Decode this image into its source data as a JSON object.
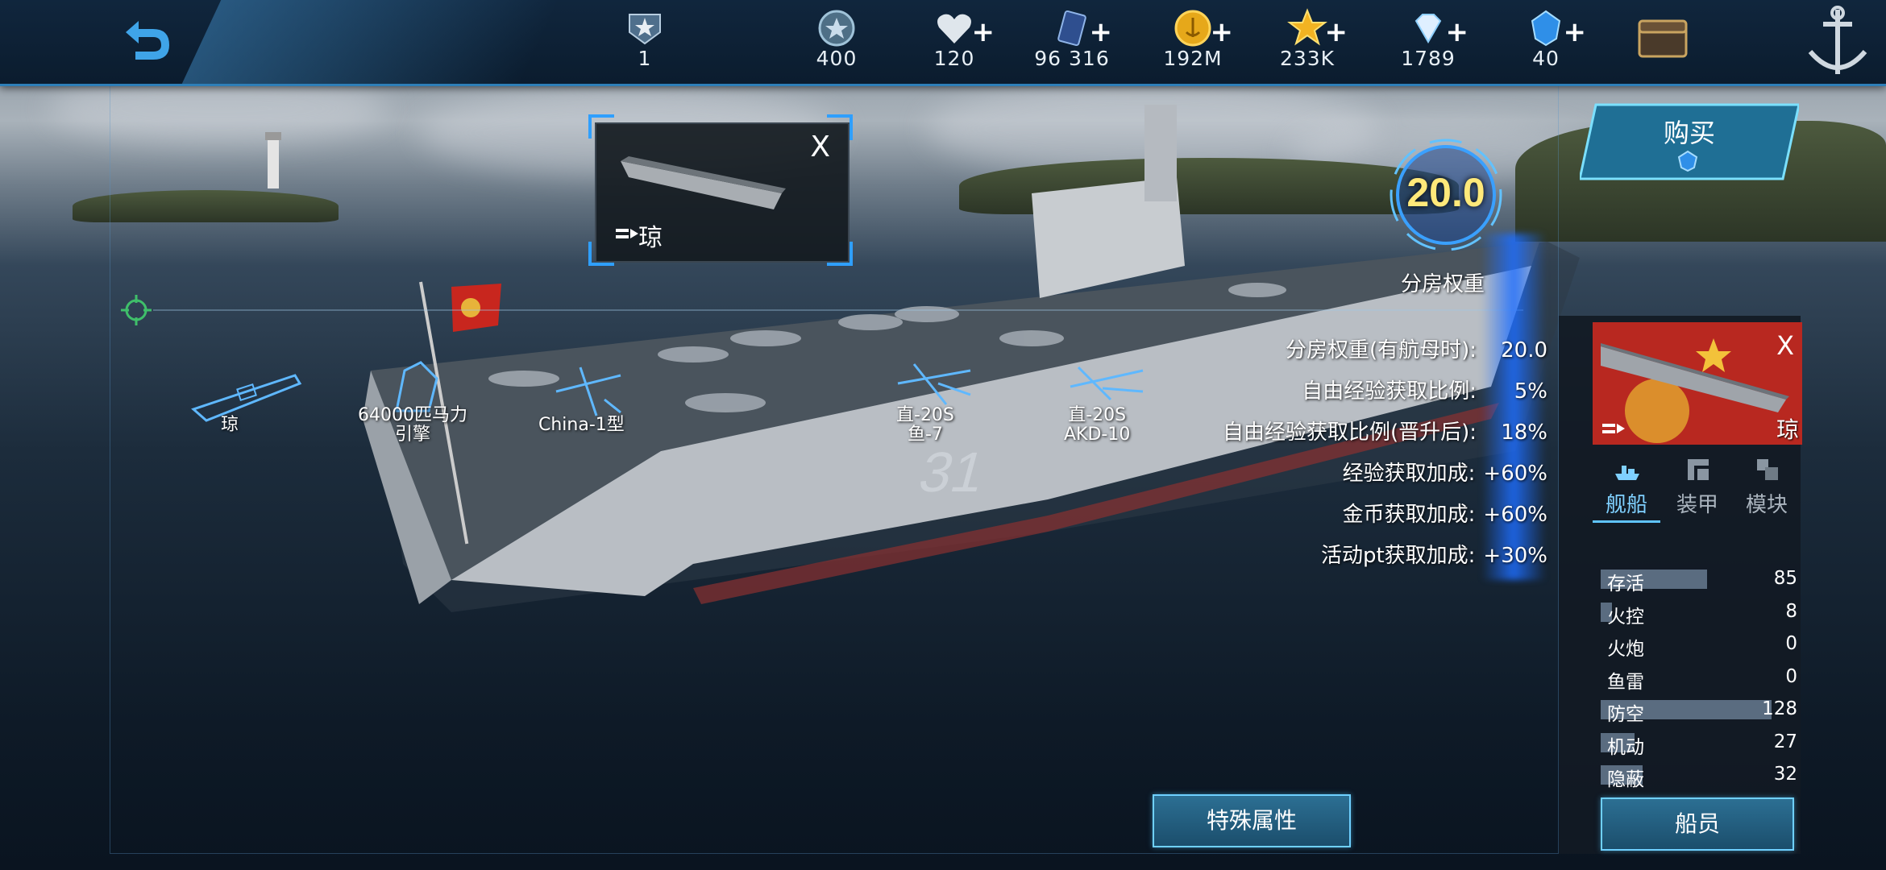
{
  "topbar": {
    "rank": {
      "icon": "rank-badge-icon",
      "value": "1"
    },
    "resources": [
      {
        "name": "steel",
        "icon": "steel-coin-icon",
        "value": "400",
        "plus": false
      },
      {
        "name": "stamina",
        "icon": "heart-icon",
        "value": "120",
        "plus": true
      },
      {
        "name": "oil",
        "icon": "oil-card-icon",
        "value": "96 316",
        "plus": true
      },
      {
        "name": "gold",
        "icon": "gold-coin-icon",
        "value": "192M",
        "plus": true
      },
      {
        "name": "star",
        "icon": "star-icon",
        "value": "233K",
        "plus": true
      },
      {
        "name": "diamond",
        "icon": "diamond-icon",
        "value": "1789",
        "plus": true
      },
      {
        "name": "crystal",
        "icon": "blue-crystal-icon",
        "value": "40",
        "plus": true
      }
    ],
    "plus_symbol": "+"
  },
  "buy_button": {
    "label": "购买"
  },
  "popup": {
    "close": "X",
    "ship_name": "琼"
  },
  "weight_gauge": {
    "value": "20.0"
  },
  "overlay_label": "分房权重",
  "stats": [
    {
      "label": "分房权重(有航母时):",
      "value": "20.0"
    },
    {
      "label": "自由经验获取比例:",
      "value": "5%"
    },
    {
      "label": "自由经验获取比例(晋升后):",
      "value": "18%"
    },
    {
      "label": "经验获取加成:",
      "value": "+60%"
    },
    {
      "label": "金币获取加成:",
      "value": "+60%"
    },
    {
      "label": "活动pt获取加成:",
      "value": "+30%"
    }
  ],
  "equipment": [
    {
      "line1": "琼",
      "line2": ""
    },
    {
      "line1": "64000匹马力",
      "line2": "引擎"
    },
    {
      "line1": "China-1型",
      "line2": ""
    },
    {
      "line1": "直-20S",
      "line2": "鱼-7"
    },
    {
      "line1": "直-20S",
      "line2": "AKD-10"
    }
  ],
  "ship_card": {
    "close": "X",
    "name": "琼"
  },
  "tabs": [
    {
      "label": "舰船",
      "icon": "ship-icon",
      "active": true
    },
    {
      "label": "装甲",
      "icon": "armor-icon",
      "active": false
    },
    {
      "label": "模块",
      "icon": "module-icon",
      "active": false
    }
  ],
  "attributes": [
    {
      "label": "存活",
      "value": "85",
      "fill": 0.56
    },
    {
      "label": "火控",
      "value": "8",
      "fill": 0.06
    },
    {
      "label": "火炮",
      "value": "0",
      "fill": 0.0
    },
    {
      "label": "鱼雷",
      "value": "0",
      "fill": 0.0
    },
    {
      "label": "防空",
      "value": "128",
      "fill": 0.9
    },
    {
      "label": "机动",
      "value": "27",
      "fill": 0.18
    },
    {
      "label": "隐蔽",
      "value": "32",
      "fill": 0.22
    }
  ],
  "buttons": {
    "special": "特殊属性",
    "crew": "船员"
  },
  "colors": {
    "accent": "#2e7fb8",
    "gauge_text": "#ffe97a",
    "bar": "#5a6c80"
  }
}
